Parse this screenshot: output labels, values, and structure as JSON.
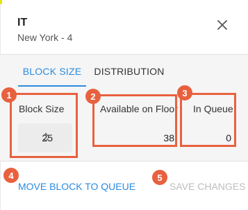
{
  "header": {
    "title": "IT",
    "subtitle": "New York - 4",
    "close_icon": "close-icon"
  },
  "tabs": [
    {
      "label": "BLOCK SIZE",
      "active": true
    },
    {
      "label": "DISTRIBUTION",
      "active": false
    }
  ],
  "fields": {
    "block_size": {
      "label": "Block Size",
      "value": "25"
    },
    "available_on_floor": {
      "label": "Available on Floor",
      "value": "38"
    },
    "in_queue": {
      "label": "In Queue",
      "value": "0"
    }
  },
  "actions": {
    "move_block": "MOVE BLOCK TO QUEUE",
    "save_changes": "SAVE CHANGES"
  },
  "callouts": [
    "1",
    "2",
    "3",
    "4",
    "5"
  ],
  "colors": {
    "accent": "#2b8be0",
    "callout": "#e8613f",
    "disabled": "#bdbdbd",
    "strip": "#e6e600"
  }
}
